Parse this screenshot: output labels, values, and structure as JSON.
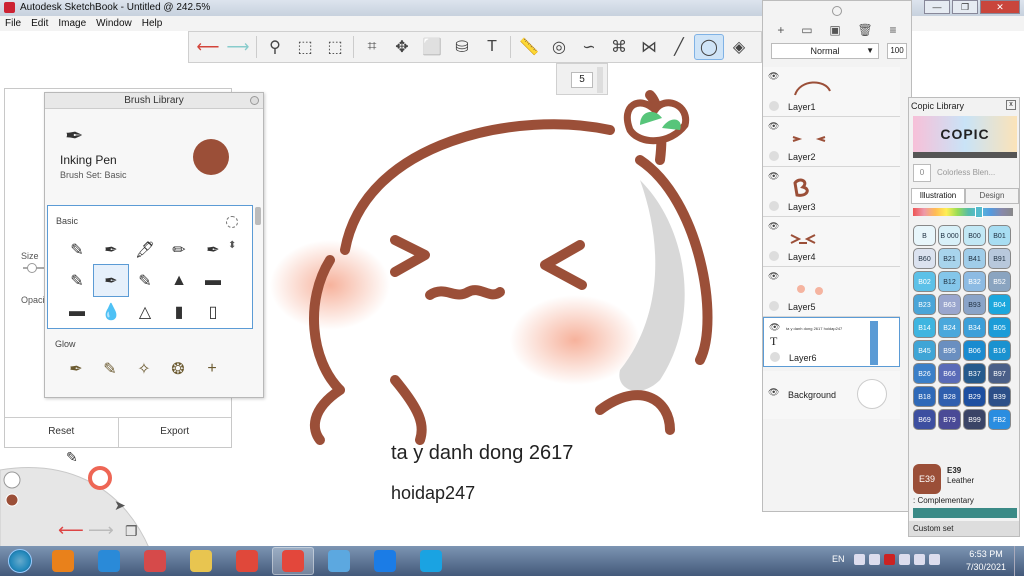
{
  "window": {
    "title": "Autodesk SketchBook - Untitled @ 242.5%",
    "controls": [
      "—",
      "❐",
      "✕"
    ]
  },
  "menu": [
    "File",
    "Edit",
    "Image",
    "Window",
    "Help"
  ],
  "toolbar": {
    "tools": [
      {
        "icon": "undo-icon",
        "glyph": "⟵"
      },
      {
        "icon": "redo-icon",
        "glyph": "⟶"
      },
      {
        "icon": "zoom-icon",
        "glyph": "⚲"
      },
      {
        "icon": "select-icon",
        "glyph": "⬚"
      },
      {
        "icon": "lasso-select-icon",
        "glyph": "⬚"
      },
      {
        "icon": "crop-icon",
        "glyph": "⌗"
      },
      {
        "icon": "transform-icon",
        "glyph": "✥"
      },
      {
        "icon": "distort-icon",
        "glyph": "⬜"
      },
      {
        "icon": "fill-icon",
        "glyph": "⛁"
      },
      {
        "icon": "text-icon",
        "glyph": "T"
      },
      {
        "icon": "ruler-icon",
        "glyph": "📏"
      },
      {
        "icon": "ellipse-guide-icon",
        "glyph": "◎"
      },
      {
        "icon": "french-curve-icon",
        "glyph": "∽"
      },
      {
        "icon": "perspective-icon",
        "glyph": "⌘"
      },
      {
        "icon": "symmetry-icon",
        "glyph": "⋈"
      },
      {
        "icon": "line-icon",
        "glyph": "╱"
      },
      {
        "icon": "ellipse-icon",
        "glyph": "◯"
      },
      {
        "icon": "shape-icon",
        "glyph": "◈"
      }
    ],
    "active_index": 16
  },
  "size_box": {
    "value": "5"
  },
  "canvas": {
    "text_line1": "ta y danh dong 2617",
    "text_line2": "hoidap247"
  },
  "brush_properties": {
    "size_label": "Size",
    "opacity_label": "Opacit",
    "reset_label": "Reset",
    "export_label": "Export"
  },
  "brush_library": {
    "title": "Brush Library",
    "brush_name": "Inking Pen",
    "brush_set": "Brush Set: Basic",
    "current_color": "#9b4f38",
    "section_basic": "Basic",
    "section_glow": "Glow",
    "basic_brushes": [
      "✎",
      "✒",
      "🖋",
      "✏",
      "✒",
      "✎",
      "✒",
      "✎",
      "▲",
      "▬",
      "▬",
      "💧",
      "△",
      "▮",
      "▯"
    ],
    "selected_brush_index": 6,
    "glow_brushes": [
      "✒",
      "✎",
      "✧",
      "❂",
      "+"
    ]
  },
  "layers": {
    "blend_mode": "Normal",
    "opacity_pct": "100",
    "items": [
      {
        "name": "Layer1",
        "visible": true,
        "selected": false
      },
      {
        "name": "Layer2",
        "visible": true,
        "selected": false
      },
      {
        "name": "Layer3",
        "visible": true,
        "selected": false
      },
      {
        "name": "Layer4",
        "visible": true,
        "selected": false
      },
      {
        "name": "Layer5",
        "visible": true,
        "selected": false
      },
      {
        "name": "Layer6",
        "visible": true,
        "selected": true
      }
    ],
    "background_label": "Background",
    "layer6_thumb_text": "ta y danh dong 2617 hoidap247"
  },
  "copic": {
    "title": "Copic Library",
    "logo_text": "COPIC",
    "colorless_code": "0",
    "colorless_label": "Colorless Blen...",
    "tabs": [
      "Illustration",
      "Design"
    ],
    "active_tab": 0,
    "swatches": [
      {
        "code": "B 0000",
        "color": "#e8f6fb"
      },
      {
        "code": "B 000",
        "color": "#d8f0f8"
      },
      {
        "code": "B00",
        "color": "#c2e8f5"
      },
      {
        "code": "B01",
        "color": "#a8ddf2"
      },
      {
        "code": "B60",
        "color": "#dbe2ef"
      },
      {
        "code": "B21",
        "color": "#a8d4ec"
      },
      {
        "code": "B41",
        "color": "#a0cde9"
      },
      {
        "code": "B91",
        "color": "#b8c8dc"
      },
      {
        "code": "B02",
        "color": "#5cc1e8"
      },
      {
        "code": "B12",
        "color": "#84c6ea"
      },
      {
        "code": "B32",
        "color": "#8dbbe3"
      },
      {
        "code": "B52",
        "color": "#8aa4c0"
      },
      {
        "code": "B23",
        "color": "#4aa5d8"
      },
      {
        "code": "B63",
        "color": "#9aa6ce"
      },
      {
        "code": "B93",
        "color": "#8aa4c8"
      },
      {
        "code": "B04",
        "color": "#1ba7dd"
      },
      {
        "code": "B14",
        "color": "#3fb5e0"
      },
      {
        "code": "B24",
        "color": "#4aa8dc"
      },
      {
        "code": "B34",
        "color": "#3c9fd9"
      },
      {
        "code": "B05",
        "color": "#1b9cd8"
      },
      {
        "code": "B45",
        "color": "#3fa5d6"
      },
      {
        "code": "B95",
        "color": "#6a8fc0"
      },
      {
        "code": "B06",
        "color": "#1a8bd0"
      },
      {
        "code": "B16",
        "color": "#1a92d0"
      },
      {
        "code": "B26",
        "color": "#3a7fc8"
      },
      {
        "code": "B66",
        "color": "#5a6bb8"
      },
      {
        "code": "B37",
        "color": "#255a8c"
      },
      {
        "code": "B97",
        "color": "#4a5f88"
      },
      {
        "code": "B18",
        "color": "#2e69b8"
      },
      {
        "code": "B28",
        "color": "#2f5fae"
      },
      {
        "code": "B29",
        "color": "#1d4fa0"
      },
      {
        "code": "B39",
        "color": "#2c4f88"
      },
      {
        "code": "B69",
        "color": "#3d4fa0"
      },
      {
        "code": "B79",
        "color": "#4a4a96"
      },
      {
        "code": "B99",
        "color": "#3a4466"
      },
      {
        "code": "FB2",
        "color": "#2a8de0"
      }
    ],
    "current_code": "E39",
    "current_name": "Leather",
    "current_color": "#9b4f38",
    "complementary_label": ": Complementary",
    "custom_set_label": "Custom set"
  },
  "taskbar": {
    "apps": [
      {
        "name": "media-player",
        "color": "#e9811b"
      },
      {
        "name": "internet-explorer",
        "color": "#2a8ad8"
      },
      {
        "name": "snipping-tool",
        "color": "#d64a4a"
      },
      {
        "name": "file-explorer",
        "color": "#e8c550"
      },
      {
        "name": "chrome",
        "color": "#e0483a"
      },
      {
        "name": "sketchbook",
        "color": "#e3473b"
      },
      {
        "name": "paint",
        "color": "#5ca8e0"
      },
      {
        "name": "zalo",
        "color": "#1b7ce6"
      },
      {
        "name": "skype",
        "color": "#1aa3e2"
      }
    ],
    "active_app": 5,
    "language": "EN",
    "time": "6:53 PM",
    "date": "7/30/2021"
  }
}
